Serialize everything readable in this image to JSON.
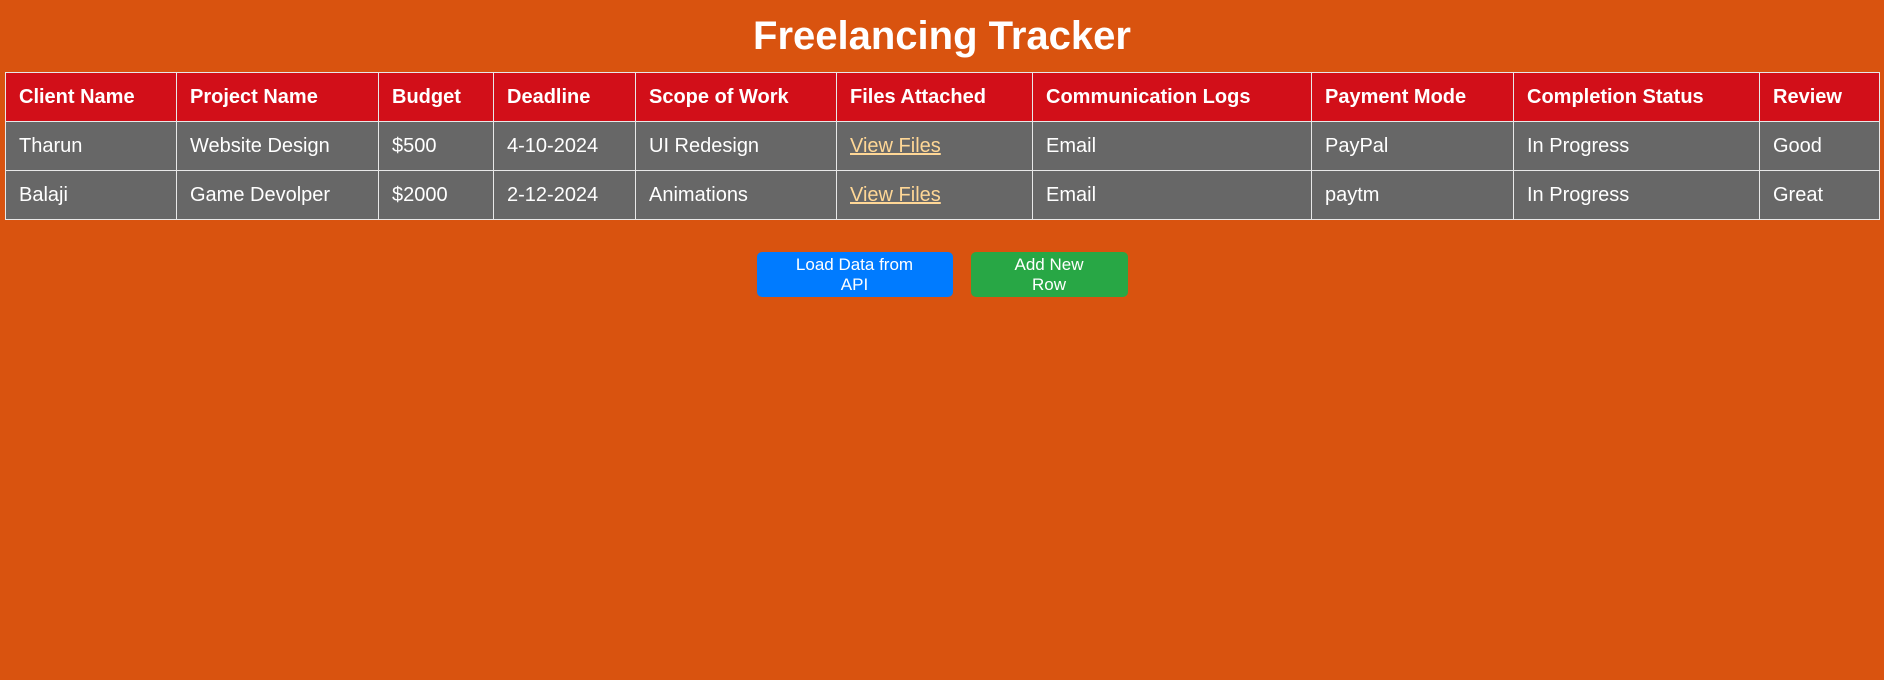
{
  "page": {
    "title": "Freelancing Tracker"
  },
  "table": {
    "headers": [
      "Client Name",
      "Project Name",
      "Budget",
      "Deadline",
      "Scope of Work",
      "Files Attached",
      "Communication Logs",
      "Payment Mode",
      "Completion Status",
      "Review"
    ],
    "rows": [
      {
        "client": "Tharun",
        "project": "Website Design",
        "budget": "$500",
        "deadline": "4-10-2024",
        "scope": "UI Redesign",
        "files": "View Files",
        "communication": "Email",
        "payment": "PayPal",
        "status": "In Progress",
        "review": "Good"
      },
      {
        "client": "Balaji",
        "project": "Game Devolper",
        "budget": "$2000",
        "deadline": "2-12-2024",
        "scope": "Animations",
        "files": "View Files",
        "communication": "Email",
        "payment": "paytm",
        "status": "In Progress",
        "review": "Great"
      }
    ]
  },
  "actions": {
    "load_label": "Load Data from API",
    "add_label": "Add New Row"
  },
  "colors": {
    "background": "#d9530f",
    "header": "#d20f19",
    "row": "#676767",
    "link": "#ffd796",
    "load_button": "#007bff",
    "add_button": "#28a745"
  }
}
